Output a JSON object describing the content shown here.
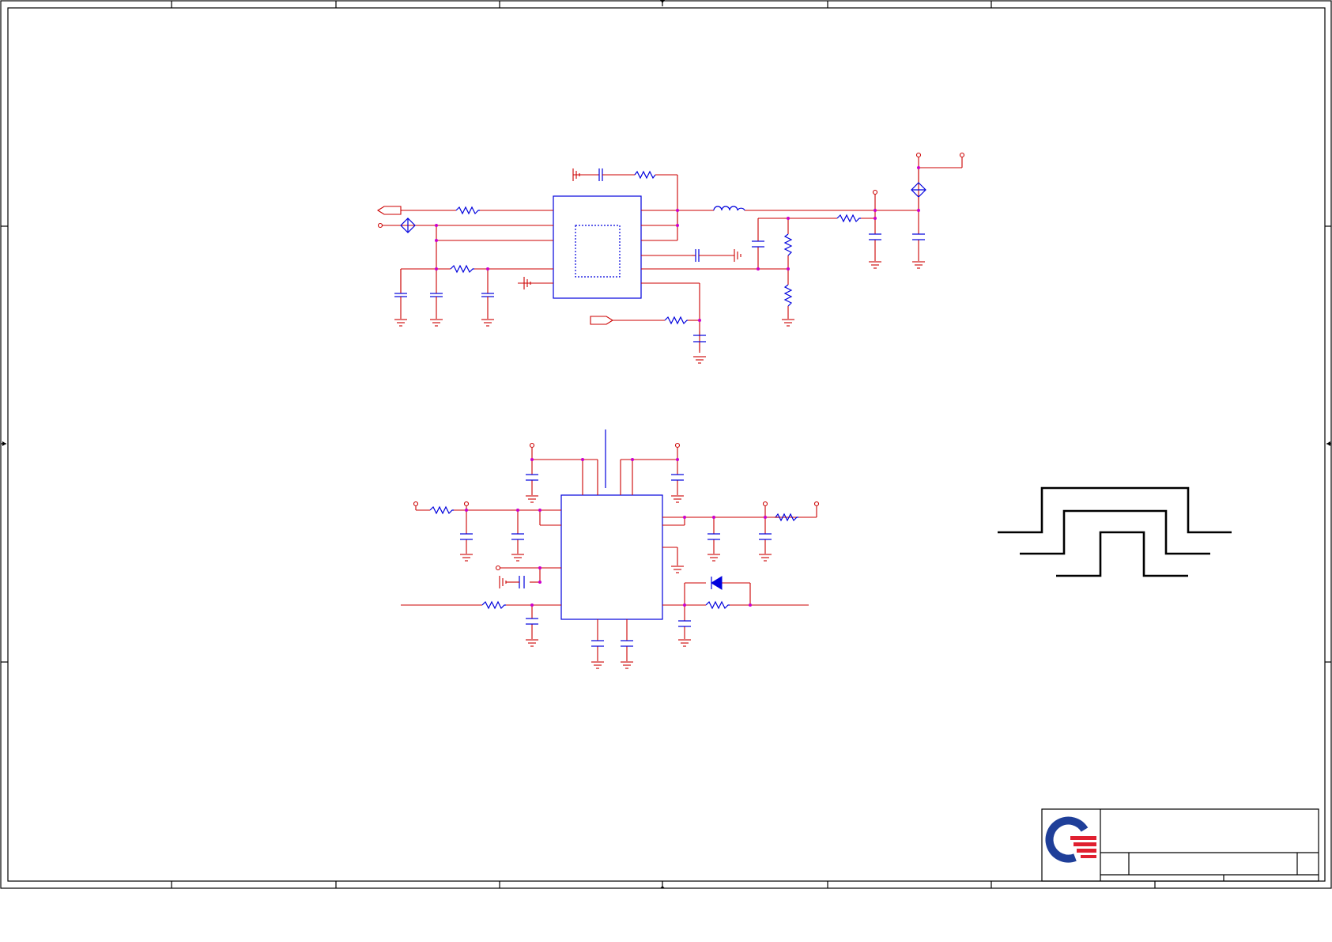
{
  "sheet": {
    "background": "#ffffff",
    "frame_color": "#000000",
    "wire_color": "#cc0000",
    "component_color": "#0000dd",
    "junction_color": "#cc00cc"
  },
  "schematic": {
    "upper_circuit": {
      "ic_outline": "solid-blue-rectangle",
      "thermal_pad": "dashed-blue-rectangle",
      "parts_visible": [
        "resistor",
        "capacitor",
        "inductor",
        "ground",
        "port",
        "power-pin",
        "bidirectional-port"
      ]
    },
    "lower_circuit": {
      "ic_outline": "solid-blue-rectangle",
      "parts_visible": [
        "resistor",
        "capacitor",
        "diode",
        "ground",
        "power-pin"
      ]
    }
  },
  "waveform": {
    "type": "nested-pulses",
    "pulse_count": 3
  },
  "title_block": {
    "logo": "company-logo",
    "logo_colors": [
      "#1f3f99",
      "#e02030"
    ]
  }
}
